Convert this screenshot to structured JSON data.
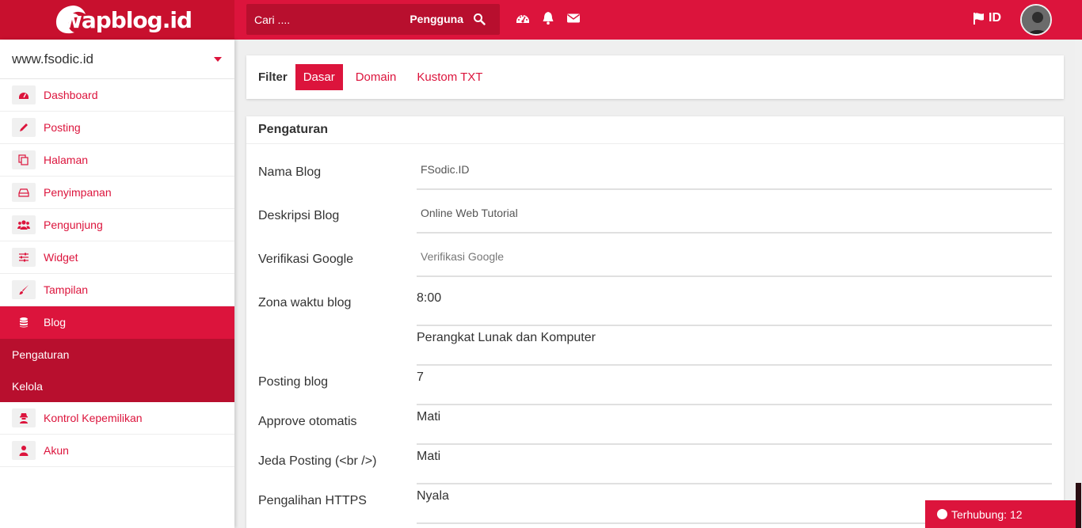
{
  "header": {
    "brand": "wapblog.id",
    "search": {
      "placeholder": "Cari ....",
      "scope_label": "Pengguna"
    },
    "icons": [
      "dashboard-icon",
      "bell-icon",
      "envelope-icon"
    ],
    "language": "ID"
  },
  "sidebar": {
    "site": "www.fsodic.id",
    "items": [
      {
        "label": "Dashboard",
        "icon": "dashboard-icon"
      },
      {
        "label": "Posting",
        "icon": "pencil-icon"
      },
      {
        "label": "Halaman",
        "icon": "pages-icon"
      },
      {
        "label": "Penyimpanan",
        "icon": "storage-icon"
      },
      {
        "label": "Pengunjung",
        "icon": "users-icon"
      },
      {
        "label": "Widget",
        "icon": "sliders-icon"
      },
      {
        "label": "Tampilan",
        "icon": "brush-icon"
      },
      {
        "label": "Blog",
        "icon": "database-icon"
      },
      {
        "label": "Kontrol Kepemilikan",
        "icon": "user-secret-icon"
      },
      {
        "label": "Akun",
        "icon": "user-icon"
      }
    ],
    "subitems": [
      {
        "label": "Pengaturan"
      },
      {
        "label": "Kelola"
      }
    ]
  },
  "filter": {
    "label": "Filter",
    "tabs": [
      {
        "label": "Dasar"
      },
      {
        "label": "Domain"
      },
      {
        "label": "Kustom TXT"
      }
    ]
  },
  "settings": {
    "title": "Pengaturan",
    "fields": {
      "nama_blog": {
        "label": "Nama Blog",
        "value": "FSodic.ID"
      },
      "deskripsi_blog": {
        "label": "Deskripsi Blog",
        "value": "Online Web Tutorial"
      },
      "verifikasi_google": {
        "label": "Verifikasi Google",
        "placeholder": "Verifikasi Google"
      },
      "zona_waktu": {
        "label": "Zona waktu blog",
        "value": "8:00"
      },
      "kategori": {
        "value": "Perangkat Lunak dan Komputer"
      },
      "posting_blog": {
        "label": "Posting blog",
        "value": "7"
      },
      "approve_otomatis": {
        "label": "Approve otomatis",
        "value": "Mati"
      },
      "jeda_posting": {
        "label": "Jeda Posting (<br />)",
        "value": "Mati"
      },
      "pengalihan_https": {
        "label": "Pengalihan HTTPS",
        "value": "Nyala"
      }
    }
  },
  "status": {
    "label": "Terhubung: 12"
  },
  "colors": {
    "accent": "#dc143c",
    "accent_dark": "#b80f2e"
  }
}
